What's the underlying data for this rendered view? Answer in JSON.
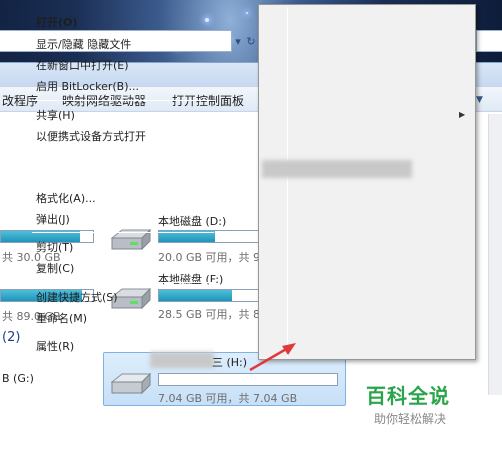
{
  "toolbar": {
    "items": [
      "改程序",
      "映射网络驱动器",
      "打开控制面板"
    ]
  },
  "address": {
    "refresh_icon": "arrow-refresh-icon"
  },
  "drives": [
    {
      "label": "",
      "info": "共 30.0 GB",
      "fill": 0.86
    },
    {
      "label": "本地磁盘 (D:)",
      "info": "20.0 GB 可用，共 9",
      "fill": 0.55
    },
    {
      "label": "",
      "info": "共 89.0 GB",
      "fill": 0.88
    },
    {
      "label": "本地磁盘 (F:)",
      "info": "28.5 GB 可用，共 8",
      "fill": 0.72
    }
  ],
  "removable_section": {
    "count": "(2)"
  },
  "removable": [
    {
      "label": "B (G:)"
    },
    {
      "label": "三 (H:)",
      "info": "7.04 GB 可用，共 7.04 GB",
      "fill": 0.0
    }
  ],
  "context_menu": {
    "items": [
      {
        "label": "打开(O)",
        "bold": true
      },
      {
        "label": "显示/隐藏 隐藏文件"
      },
      {
        "label": "在新窗口中打开(E)"
      },
      {
        "label": "启用 BitLocker(B)..."
      },
      {
        "label": "共享(H)",
        "submenu": true
      },
      {
        "label": "以便携式设备方式打开"
      },
      {
        "label": "格式化(A)..."
      },
      {
        "label": "弹出(J)"
      },
      {
        "label": "剪切(T)"
      },
      {
        "label": "复制(C)"
      },
      {
        "label": "创建快捷方式(S)"
      },
      {
        "label": "重命名(M)"
      },
      {
        "label": "属性(R)"
      }
    ]
  },
  "annotation": {
    "color": "#e0393b"
  },
  "watermark": {
    "title": "百科全说",
    "subtitle": "助你轻松解决"
  },
  "colors": {
    "bar_fill": "#1f94b8",
    "selection": "#c7e0f7",
    "menu_bg": "#f1f1f1"
  }
}
